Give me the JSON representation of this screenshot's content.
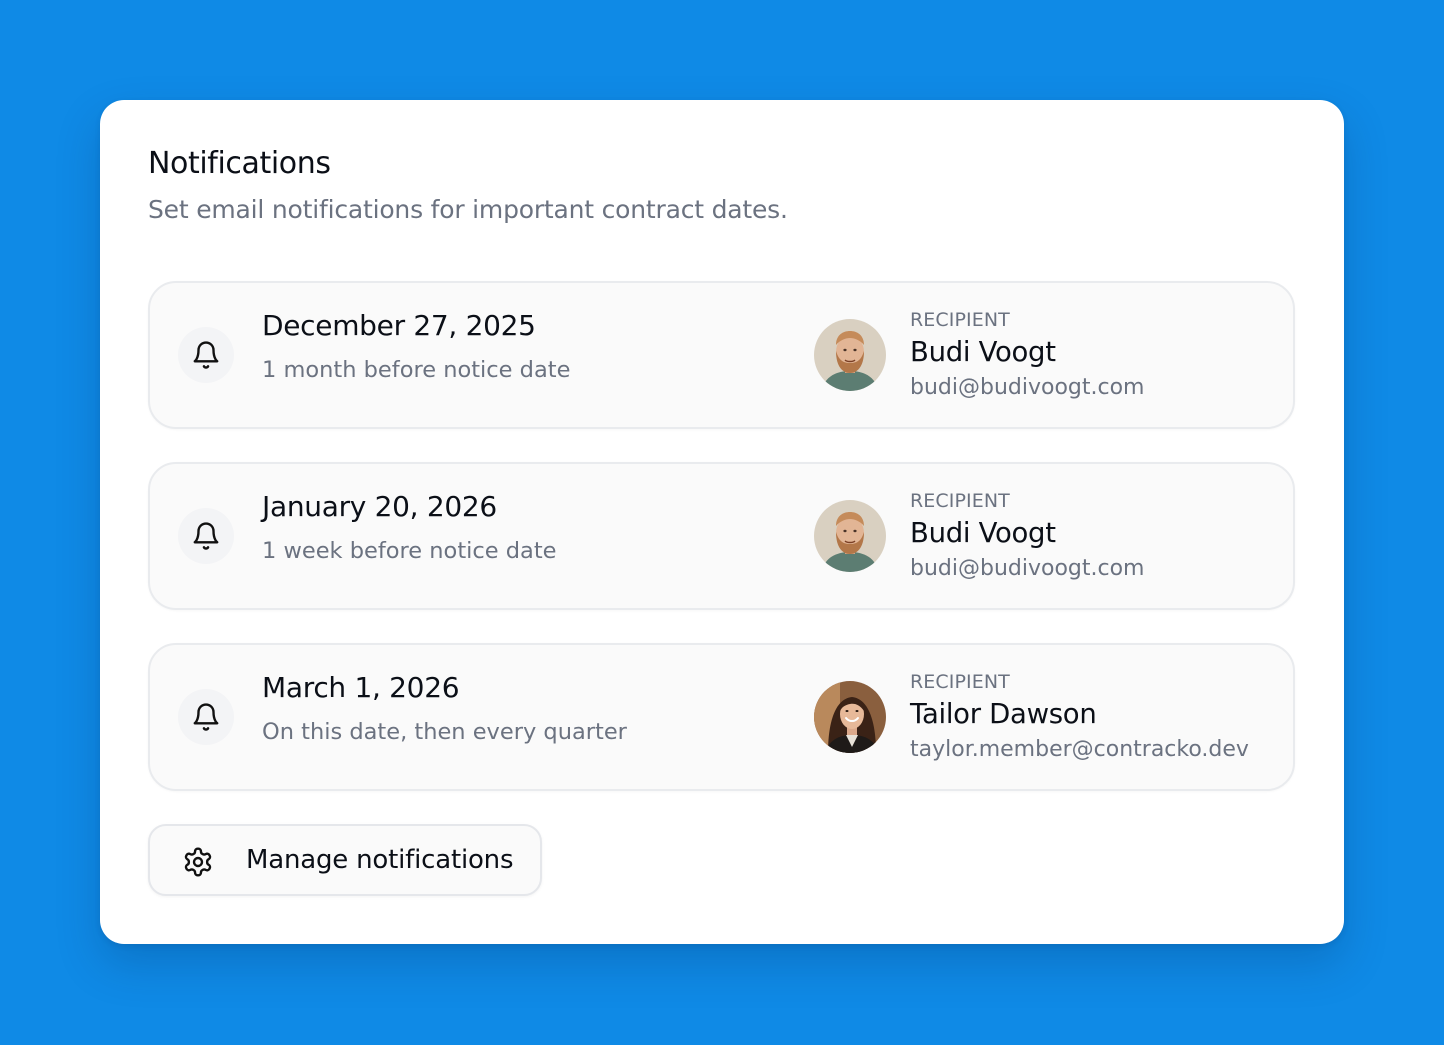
{
  "colors": {
    "background": "#0f8ae6",
    "card": "#ffffff",
    "text_primary": "#0b0f17",
    "text_secondary": "#6b7280"
  },
  "header": {
    "title": "Notifications",
    "subtitle": "Set email notifications for important contract dates."
  },
  "notifications": [
    {
      "date": "December 27, 2025",
      "rule": "1 month before notice date",
      "icon": "bell-icon",
      "recipient": {
        "label": "RECIPIENT",
        "name": "Budi Voogt",
        "email": "budi@budivoogt.com",
        "avatar": "avatar-photo"
      }
    },
    {
      "date": "January 20, 2026",
      "rule": "1 week before notice date",
      "icon": "bell-icon",
      "recipient": {
        "label": "RECIPIENT",
        "name": "Budi Voogt",
        "email": "budi@budivoogt.com",
        "avatar": "avatar-photo"
      }
    },
    {
      "date": "March 1, 2026",
      "rule": "On this date, then every quarter",
      "icon": "bell-icon",
      "recipient": {
        "label": "RECIPIENT",
        "name": "Tailor Dawson",
        "email": "taylor.member@contracko.dev",
        "avatar": "avatar-photo"
      }
    }
  ],
  "actions": {
    "manage_label": "Manage notifications",
    "manage_icon": "gear-icon"
  }
}
